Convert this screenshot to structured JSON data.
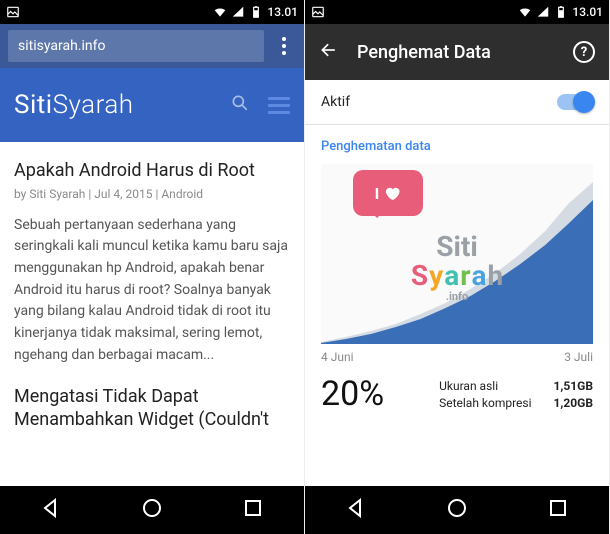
{
  "status": {
    "time": "13.01"
  },
  "left": {
    "url": "sitisyarah.info",
    "logo_a": "Siti",
    "logo_b": "Syarah",
    "articles": [
      {
        "title": "Apakah Android Harus di Root",
        "meta": "by Siti Syarah | Jul 4, 2015 | Android",
        "body": "Sebuah pertanyaan sederhana yang seringkali kali muncul ketika kamu baru saja menggunakan hp Android, apakah benar Android itu harus di root? Soalnya banyak yang bilang kalau Android tidak di root itu kinerjanya tidak maksimal, sering lemot, ngehang dan berbagai macam..."
      },
      {
        "title": "Mengatasi Tidak Dapat Menambahkan Widget (Couldn't",
        "meta": "",
        "body": ""
      }
    ]
  },
  "right": {
    "title": "Penghemat Data",
    "toggle_label": "Aktif",
    "section": "Penghematan data",
    "wm_bubble": "I",
    "wm_l1": "Siti",
    "wm_l2": "Syarah",
    "wm_info": ".info",
    "date_start": "4 Juni",
    "date_end": "3 Juli",
    "pct": "20%",
    "stats": {
      "orig_label": "Ukuran asli",
      "orig_val": "1,51GB",
      "comp_label": "Setelah kompresi",
      "comp_val": "1,20GB"
    }
  },
  "chart_data": {
    "type": "area",
    "series": [
      {
        "name": "Ukuran asli",
        "color": "#d5dbe3",
        "values": [
          0,
          4,
          9,
          14,
          20,
          27,
          35,
          44,
          55,
          68,
          83,
          100
        ]
      },
      {
        "name": "Setelah kompresi",
        "color": "#3a6fb7",
        "values": [
          0,
          3,
          6,
          10,
          15,
          20,
          26,
          34,
          43,
          53,
          65,
          80
        ]
      }
    ],
    "xstart": "4 Juni",
    "xend": "3 Juli",
    "ylim": [
      0,
      100
    ]
  }
}
